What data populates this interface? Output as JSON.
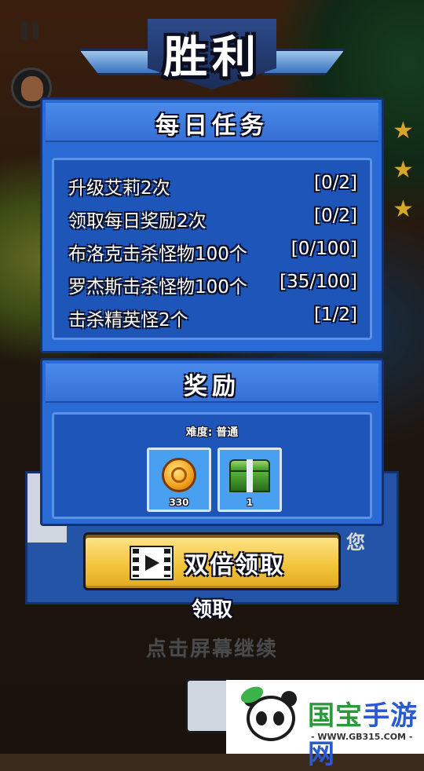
{
  "title": "胜利",
  "daily_tasks": {
    "heading": "每日任务",
    "tasks": [
      {
        "name": "升级艾莉2次",
        "progress": "[0/2]"
      },
      {
        "name": "领取每日奖励2次",
        "progress": "[0/2]"
      },
      {
        "name": "布洛克击杀怪物100个",
        "progress": "[0/100]"
      },
      {
        "name": "罗杰斯击杀怪物100个",
        "progress": "[35/100]"
      },
      {
        "name": "击杀精英怪2个",
        "progress": "[1/2]"
      }
    ]
  },
  "rewards": {
    "heading": "奖励",
    "difficulty": "难度: 普通",
    "items": [
      {
        "icon": "gold-coin-icon",
        "count": "330"
      },
      {
        "icon": "green-chest-icon",
        "count": "1"
      }
    ]
  },
  "actions": {
    "double_claim": "双倍领取",
    "claim": "领取",
    "tap_to_continue": "点击屏幕继续"
  },
  "background_text": "您",
  "watermark": {
    "name_part1": "国宝",
    "name_part2": "手游网",
    "url": "- WWW.GB315.COM -"
  },
  "colors": {
    "panel_blue": "#2a6ad4",
    "button_yellow": "#f2c33a",
    "star_gold": "#d4a72a"
  }
}
